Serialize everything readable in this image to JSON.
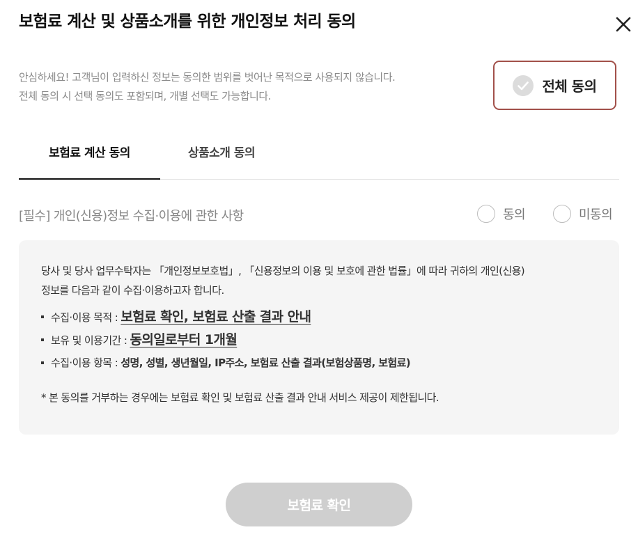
{
  "dialog": {
    "title": "보험료 계산 및 상품소개를 위한 개인정보 처리 동의",
    "notice_line1": "안심하세요! 고객님이 입력하신 정보는 동의한 범위를 벗어난 목적으로 사용되지 않습니다.",
    "notice_line2": "전체 동의 시 선택 동의도 포함되며, 개별 선택도 가능합니다.",
    "agree_all_label": "전체 동의"
  },
  "tabs": [
    {
      "label": "보험료 계산 동의",
      "active": true
    },
    {
      "label": "상품소개 동의",
      "active": false
    }
  ],
  "section": {
    "required_label": "[필수] 개인(신용)정보 수집·이용에 관한 사항",
    "agree_label": "동의",
    "disagree_label": "미동의"
  },
  "content": {
    "intro_line1": "당사 및 당사 업무수탁자는 「개인정보보호법」, 「신용정보의 이용 및 보호에 관한 법률」에 따라 귀하의 개인(신용)",
    "intro_line2": "정보를 다음과 같이 수집·이용하고자 합니다.",
    "items": [
      {
        "label": "수집·이용 목적 : ",
        "value": "보험료 확인, 보험료 산출 결과 안내"
      },
      {
        "label": "보유 및 이용기간 : ",
        "value": "동의일로부터 1개월"
      },
      {
        "label": "수집·이용 항목 : ",
        "value": "성명, 성별, 생년월일, IP주소, 보험료 산출 결과(보험상품명, 보험료)"
      }
    ],
    "footnote": "* 본 동의를 거부하는 경우에는 보험료 확인 및 보험료 산출 결과 안내 서비스 제공이 제한됩니다."
  },
  "confirm_label": "보험료 확인",
  "colors": {
    "accent_border": "#a2504a",
    "button_disabled": "#cfcfcf",
    "panel_bg": "#f5f5f5"
  },
  "icons": {
    "close": "close-icon",
    "agree_all": "check-circle-icon"
  }
}
